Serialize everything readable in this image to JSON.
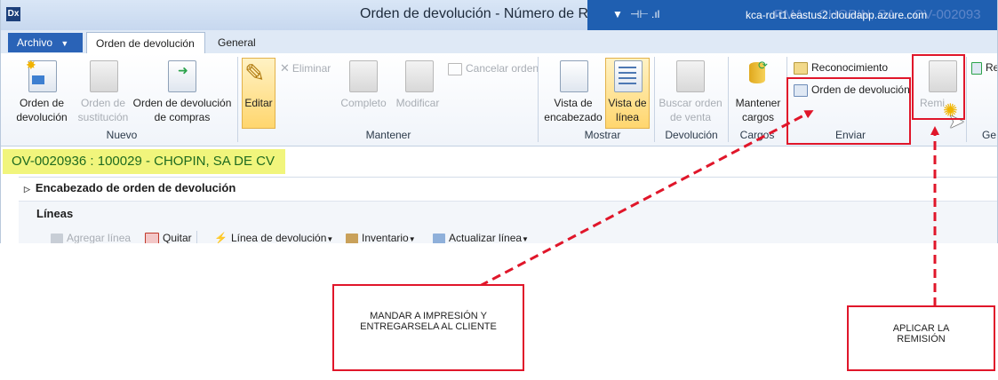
{
  "window": {
    "title": "Orden de devolución - Número de RMA:",
    "overlay_text": "RMA... CHOPIN, SA ... OV-002093",
    "host": "kca-rd-t1.eastus2.cloudapp.azure.com"
  },
  "tabs": {
    "file": "Archivo",
    "return_order": "Orden de devolución",
    "general": "General"
  },
  "ribbon": {
    "nuevo": {
      "label": "Nuevo",
      "items": [
        {
          "line1": "Orden de",
          "line2": "devolución"
        },
        {
          "line1": "Orden de",
          "line2": "sustitución"
        },
        {
          "line1": "Orden de devolución",
          "line2": "de compras"
        }
      ]
    },
    "mantener": {
      "label": "Mantener",
      "editar": "Editar",
      "eliminar": "Eliminar",
      "cancelar": "Cancelar orden",
      "completo": "Completo",
      "modificar": "Modificar"
    },
    "mostrar": {
      "label": "Mostrar",
      "vista_enc": {
        "line1": "Vista de",
        "line2": "encabezado"
      },
      "vista_lin": {
        "line1": "Vista de",
        "line2": "línea"
      }
    },
    "devolucion": {
      "label": "Devolución",
      "buscar": {
        "line1": "Buscar orden",
        "line2": "de venta"
      }
    },
    "cargos": {
      "label": "Cargos",
      "mantener": {
        "line1": "Mantener",
        "line2": "cargos"
      }
    },
    "enviar": {
      "label": "Enviar",
      "reconocimiento": "Reconocimiento",
      "orden": "Orden de devolución",
      "remision": "Remi"
    },
    "partial": {
      "re": "Re",
      "ge": "Ge"
    }
  },
  "record": {
    "title": "OV-0020936 : 100029 - CHOPIN, SA DE CV",
    "header_fasttab": "Encabezado de orden de devolución",
    "lines_label": "Líneas"
  },
  "lines_toolbar": {
    "agregar": "Agregar línea",
    "quitar": "Quitar",
    "linea_dev": "Línea de devolución",
    "inventario": "Inventario",
    "actualizar": "Actualizar línea"
  },
  "annotations": {
    "callout1": {
      "line1": "MANDAR A IMPRESIÓN Y",
      "line2": "ENTREGARSELA AL CLIENTE"
    },
    "callout2": {
      "line1": "APLICAR LA",
      "line2": "REMISIÓN"
    },
    "color": "#e0162a"
  }
}
